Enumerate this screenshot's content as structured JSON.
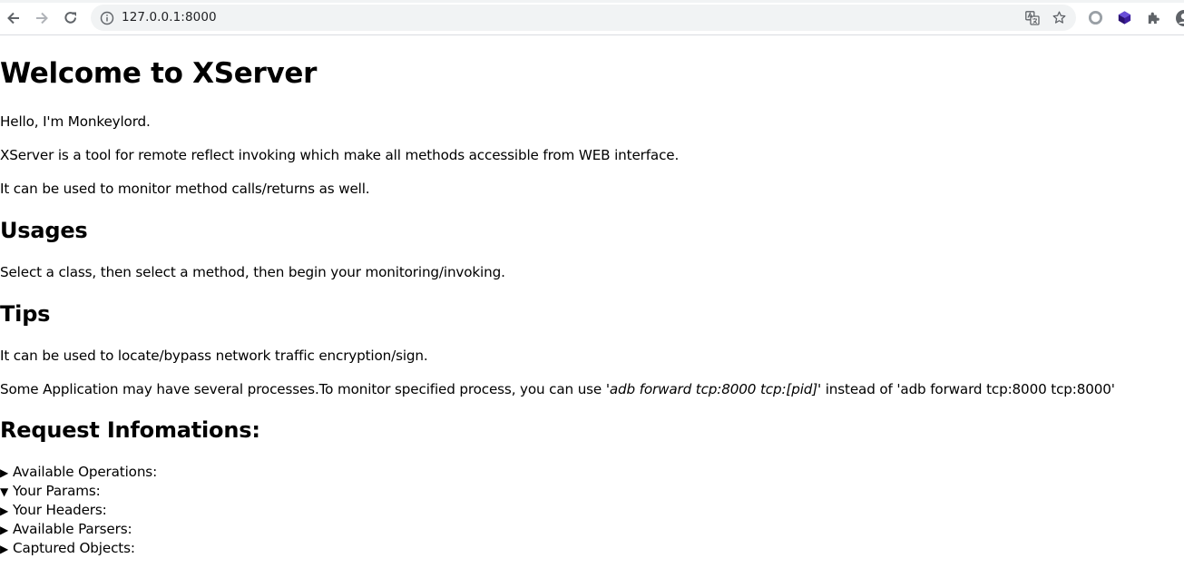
{
  "browser": {
    "url": "127.0.0.1:8000",
    "icons": [
      "back-icon",
      "forward-icon",
      "reload-icon",
      "info-icon",
      "translate-icon",
      "star-icon",
      "extension-circle-icon",
      "extension-cube-icon",
      "puzzle-icon",
      "profile-icon"
    ]
  },
  "page": {
    "title": "Welcome to XServer",
    "intro": [
      "Hello, I'm Monkeylord.",
      "XServer is a tool for remote reflect invoking which make all methods accessible from WEB interface.",
      "It can be used to monitor method calls/returns as well."
    ],
    "usages_heading": "Usages",
    "usages_text": "Select a class, then select a method, then begin your monitoring/invoking.",
    "tips_heading": "Tips",
    "tips_text1": "It can be used to locate/bypass network traffic encryption/sign.",
    "tips_text2_before": "Some Application may have several processes.To monitor specified process, you can use ",
    "tips_text2_cmd": "'adb forward tcp:8000 tcp:[pid]'",
    "tips_text2_after": " instead of 'adb forward tcp:8000 tcp:8000'",
    "request_heading": "Request Infomations:",
    "details": [
      {
        "marker": "▶",
        "label": "Available Operations:",
        "open": false
      },
      {
        "marker": "▼",
        "label": "Your Params:",
        "open": true
      },
      {
        "marker": "▶",
        "label": "Your Headers:",
        "open": false
      },
      {
        "marker": "▶",
        "label": "Available Parsers:",
        "open": false
      },
      {
        "marker": "▶",
        "label": "Captured Objects:",
        "open": false
      }
    ]
  }
}
